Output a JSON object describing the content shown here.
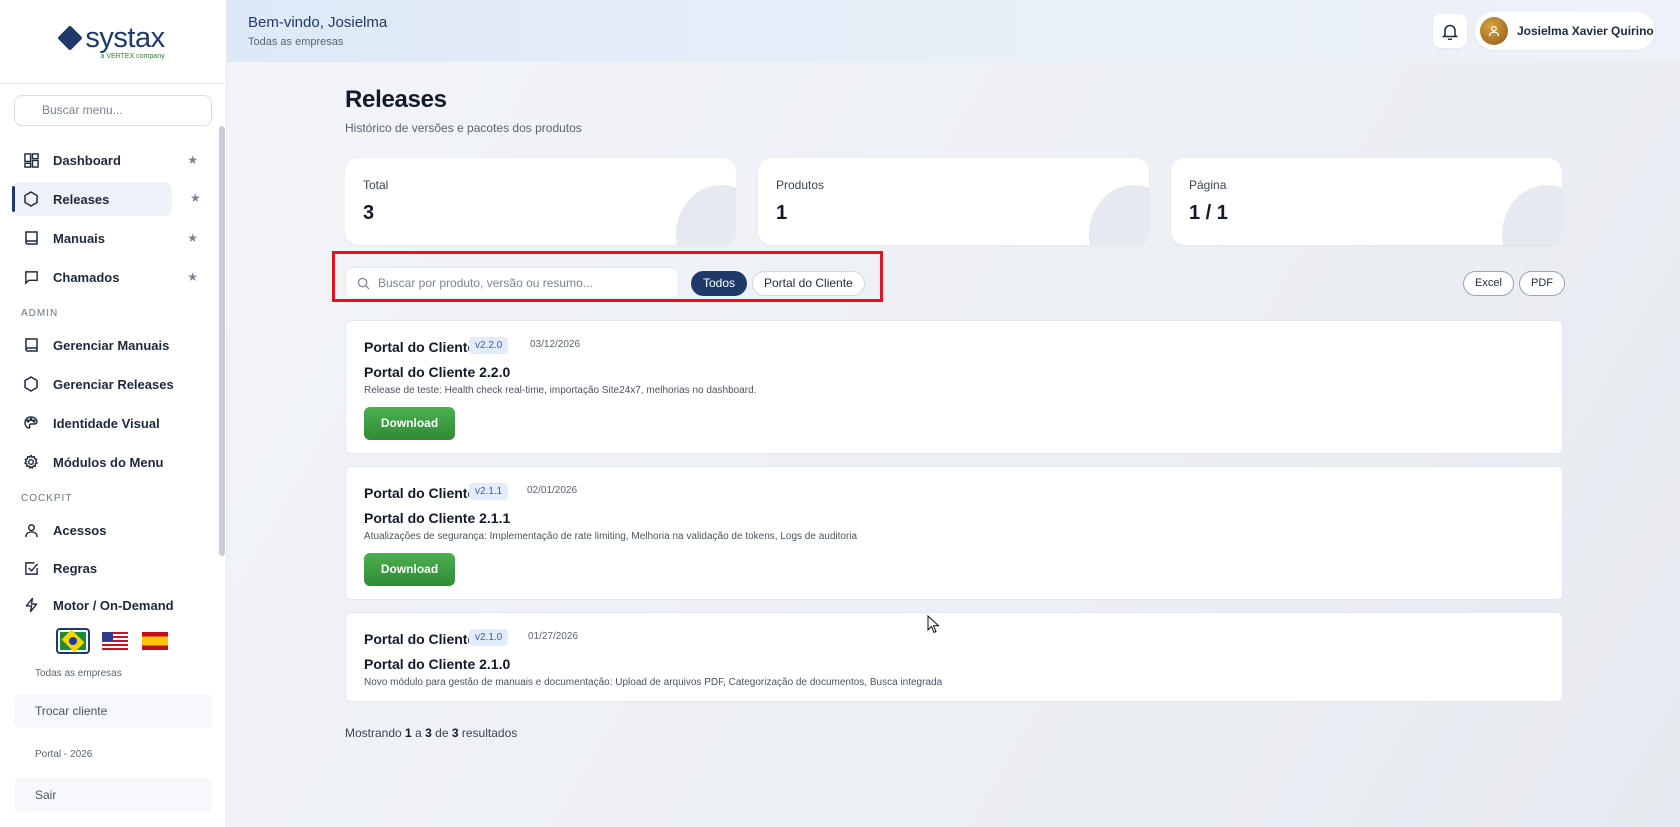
{
  "brand": {
    "name": "systax",
    "tagline": "a VERTEX company"
  },
  "sidebar": {
    "search_placeholder": "Buscar menu...",
    "items": [
      {
        "label": "Dashboard",
        "icon": "dashboard-icon",
        "starred": true
      },
      {
        "label": "Releases",
        "icon": "hexagon-icon",
        "starred": true,
        "active": true
      },
      {
        "label": "Manuais",
        "icon": "book-icon",
        "starred": true
      },
      {
        "label": "Chamados",
        "icon": "chat-icon",
        "starred": true
      }
    ],
    "admin_section": "ADMIN",
    "admin_items": [
      {
        "label": "Gerenciar Manuais",
        "icon": "book-icon"
      },
      {
        "label": "Gerenciar Releases",
        "icon": "hexagon-icon"
      },
      {
        "label": "Identidade Visual",
        "icon": "palette-icon"
      },
      {
        "label": "Módulos do Menu",
        "icon": "gear-icon"
      }
    ],
    "cockpit_section": "COCKPIT",
    "cockpit_items": [
      {
        "label": "Acessos",
        "icon": "user-icon"
      },
      {
        "label": "Regras",
        "icon": "checkbox-icon"
      },
      {
        "label": "Motor / On-Demand",
        "icon": "lightning-icon"
      }
    ],
    "languages": [
      "pt-BR",
      "en-US",
      "es-ES"
    ],
    "company_scope": "Todas as empresas",
    "switch_client_label": "Trocar cliente",
    "footer_note": "Portal - 2026",
    "logout_label": "Sair"
  },
  "topbar": {
    "welcome": "Bem-vindo, Josielma",
    "scope": "Todas as empresas",
    "user_name": "Josielma Xavier Quirino"
  },
  "page": {
    "title": "Releases",
    "subtitle": "Histórico de versões e pacotes dos produtos"
  },
  "stats": [
    {
      "label": "Total",
      "value": "3"
    },
    {
      "label": "Produtos",
      "value": "1"
    },
    {
      "label": "Página",
      "value": "1 / 1"
    }
  ],
  "filters": {
    "search_placeholder": "Buscar por produto, versão ou resumo...",
    "chips": [
      "Todos",
      "Portal do Cliente"
    ],
    "selected": "Todos",
    "export": [
      "Excel",
      "PDF"
    ]
  },
  "releases": [
    {
      "product": "Portal do Cliente",
      "version": "v2.2.0",
      "date": "03/12/2026",
      "title": "Portal do Cliente 2.2.0",
      "description": "Release de teste: Health check real-time, importação Site24x7, melhorias no dashboard.",
      "download_label": "Download"
    },
    {
      "product": "Portal do Cliente",
      "version": "v2.1.1",
      "date": "02/01/2026",
      "title": "Portal do Cliente 2.1.1",
      "description": "Atualizações de segurança: Implementação de rate limiting, Melhoria na validação de tokens, Logs de auditoria",
      "download_label": "Download"
    },
    {
      "product": "Portal do Cliente",
      "version": "v2.1.0",
      "date": "01/27/2026",
      "title": "Portal do Cliente 2.1.0",
      "description": "Novo módulo para gestão de manuais e documentação: Upload de arquivos PDF, Categorização de documentos, Busca integrada"
    }
  ],
  "pagination": {
    "prefix": "Mostrando",
    "from": "1",
    "sep1": "a",
    "to": "3",
    "sep2": "de",
    "total": "3",
    "suffix": "resultados"
  },
  "colors": {
    "primary": "#1f3a68",
    "download": "#3e9d43",
    "highlight_box": "#e0151c"
  }
}
